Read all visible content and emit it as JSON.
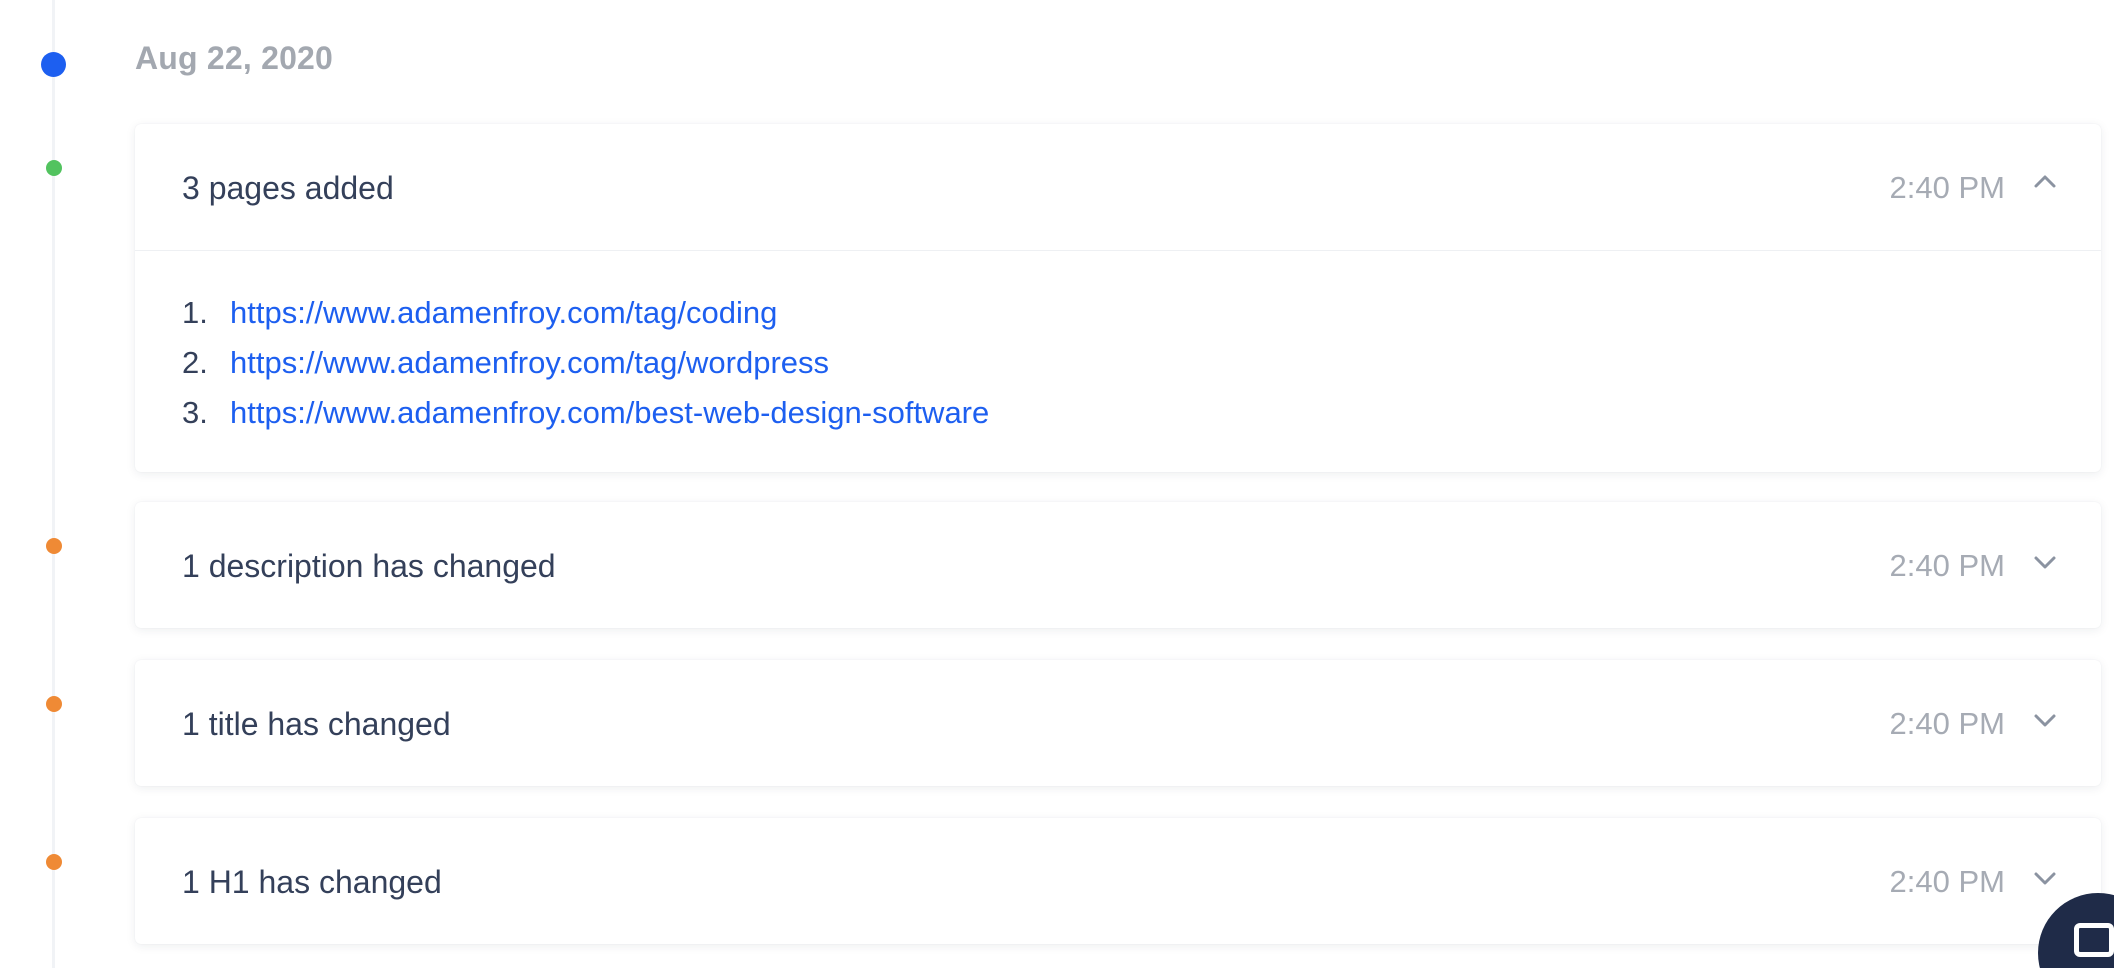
{
  "timeline": {
    "date": "Aug 22, 2020",
    "events": [
      {
        "title": "3 pages added",
        "time": "2:40 PM",
        "expanded": true,
        "dot_color": "#52c35f",
        "links": [
          {
            "num": "1.",
            "url": "https://www.adamenfroy.com/tag/coding"
          },
          {
            "num": "2.",
            "url": "https://www.adamenfroy.com/tag/wordpress"
          },
          {
            "num": "3.",
            "url": "https://www.adamenfroy.com/best-web-design-software"
          }
        ]
      },
      {
        "title": "1 description has changed",
        "time": "2:40 PM",
        "expanded": false,
        "dot_color": "#ef8a35"
      },
      {
        "title": "1 title has changed",
        "time": "2:40 PM",
        "expanded": false,
        "dot_color": "#ef8a35"
      },
      {
        "title": "1 H1 has changed",
        "time": "2:40 PM",
        "expanded": false,
        "dot_color": "#ef8a35"
      }
    ]
  },
  "colors": {
    "date_dot": "#1d5ff0",
    "link": "#1d5ff0",
    "text": "#34405a",
    "muted": "#a6abb4",
    "chat_button": "#1f2b48"
  },
  "icons": {
    "expanded": "chevron-up-icon",
    "collapsed": "chevron-down-icon",
    "chat": "chat-icon"
  }
}
